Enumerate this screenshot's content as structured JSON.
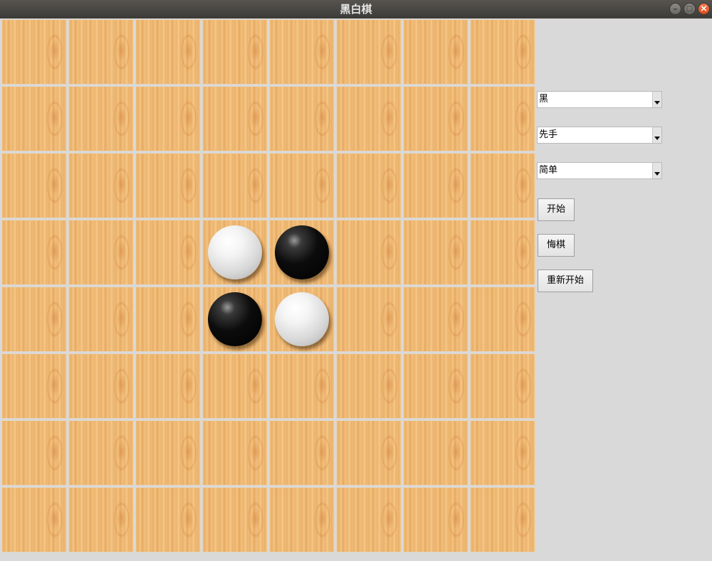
{
  "window": {
    "title": "黑白棋"
  },
  "board": {
    "size": 8,
    "stones": [
      {
        "row": 3,
        "col": 3,
        "color": "white"
      },
      {
        "row": 3,
        "col": 4,
        "color": "black"
      },
      {
        "row": 4,
        "col": 3,
        "color": "black"
      },
      {
        "row": 4,
        "col": 4,
        "color": "white"
      }
    ]
  },
  "controls": {
    "player_color_select": {
      "value": "黑"
    },
    "turn_order_select": {
      "value": "先手"
    },
    "difficulty_select": {
      "value": "简单"
    },
    "start_button": "开始",
    "undo_button": "悔棋",
    "restart_button": "重新开始"
  },
  "colors": {
    "titlebar": "#3d3b37",
    "panel": "#d9d9d9",
    "close_button": "#e5561f"
  }
}
